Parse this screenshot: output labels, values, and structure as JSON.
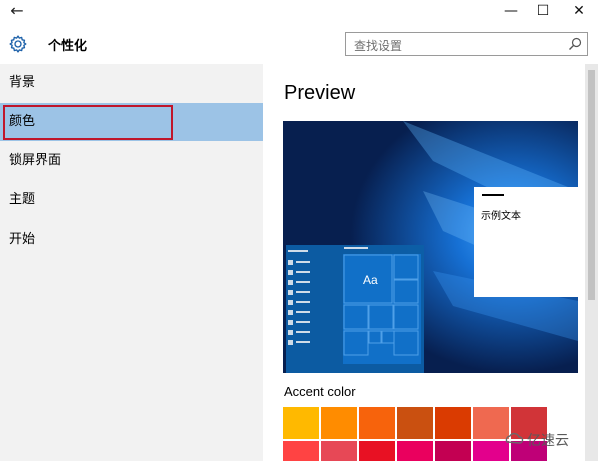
{
  "window": {
    "back_icon": "arrow-left-icon",
    "minimize": "—",
    "maximize": "☐",
    "close": "✕"
  },
  "header": {
    "title": "个性化",
    "settings_icon": "gear-icon",
    "search_placeholder": "查找设置",
    "search_icon": "search-icon"
  },
  "sidebar": {
    "items": [
      {
        "label": "背景"
      },
      {
        "label": "颜色",
        "selected": true
      },
      {
        "label": "锁屏界面"
      },
      {
        "label": "主题"
      },
      {
        "label": "开始"
      }
    ]
  },
  "main": {
    "heading": "Preview",
    "preview": {
      "dialog_text": "示例文本",
      "tile_label": "Aa"
    },
    "accent_label": "Accent color",
    "accent_swatches": [
      [
        "#ffb900",
        "#ff8c00",
        "#f7630c",
        "#ca5010",
        "#da3b01",
        "#ef6950",
        "#d13438"
      ],
      [
        "#ff4343",
        "#e74856",
        "#e81123",
        "#ea005e",
        "#c30052",
        "#e3008c",
        "#bf0077"
      ]
    ]
  },
  "colors": {
    "selected_nav": "#9cc3e6",
    "highlight_border": "#c0162b",
    "sidebar_bg": "#f2f2f2"
  },
  "watermark": {
    "text": "亿速云"
  }
}
